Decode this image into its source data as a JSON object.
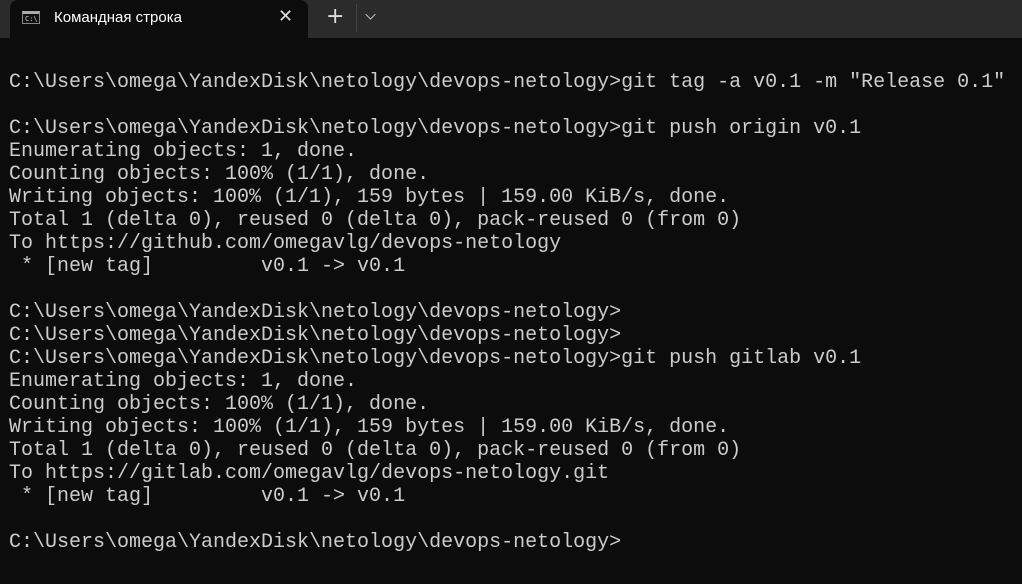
{
  "tab": {
    "title": "Командная строка",
    "icon": "cmd-icon",
    "close": "✕"
  },
  "tabbar": {
    "new_tab": "+",
    "dropdown": "chevron-down-icon"
  },
  "terminal": {
    "lines": [
      "",
      "C:\\Users\\omega\\YandexDisk\\netology\\devops-netology>git tag -a v0.1 -m \"Release 0.1\"",
      "",
      "C:\\Users\\omega\\YandexDisk\\netology\\devops-netology>git push origin v0.1",
      "Enumerating objects: 1, done.",
      "Counting objects: 100% (1/1), done.",
      "Writing objects: 100% (1/1), 159 bytes | 159.00 KiB/s, done.",
      "Total 1 (delta 0), reused 0 (delta 0), pack-reused 0 (from 0)",
      "To https://github.com/omegavlg/devops-netology",
      " * [new tag]         v0.1 -> v0.1",
      "",
      "C:\\Users\\omega\\YandexDisk\\netology\\devops-netology>",
      "C:\\Users\\omega\\YandexDisk\\netology\\devops-netology>",
      "C:\\Users\\omega\\YandexDisk\\netology\\devops-netology>git push gitlab v0.1",
      "Enumerating objects: 1, done.",
      "Counting objects: 100% (1/1), done.",
      "Writing objects: 100% (1/1), 159 bytes | 159.00 KiB/s, done.",
      "Total 1 (delta 0), reused 0 (delta 0), pack-reused 0 (from 0)",
      "To https://gitlab.com/omegavlg/devops-netology.git",
      " * [new tag]         v0.1 -> v0.1",
      "",
      "C:\\Users\\omega\\YandexDisk\\netology\\devops-netology>"
    ]
  }
}
